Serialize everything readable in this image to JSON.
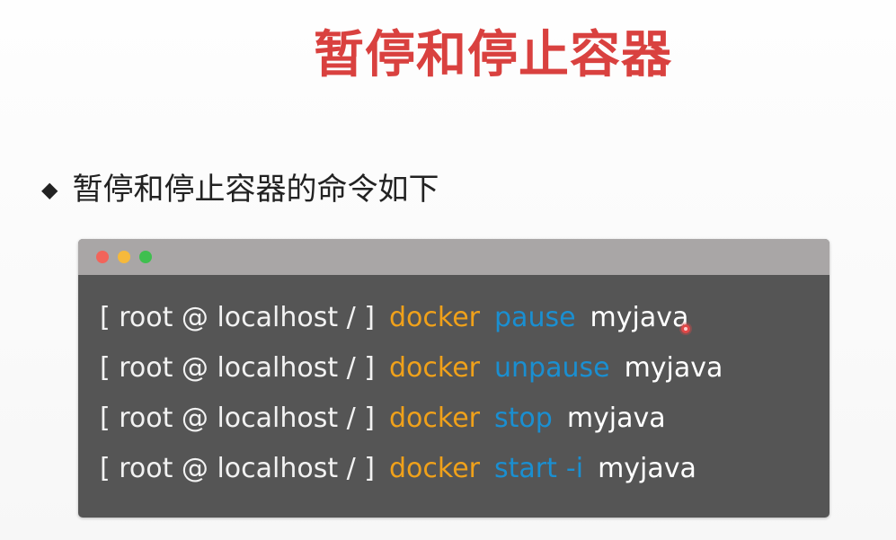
{
  "slide": {
    "title": "暂停和停止容器",
    "bullet_text": "暂停和停止容器的命令如下",
    "bullet_icon": "diamond-bullet-icon"
  },
  "terminal": {
    "window_controls": [
      "close-dot",
      "minimize-dot",
      "maximize-dot"
    ],
    "lines": [
      {
        "prompt": "[ root @ localhost / ]",
        "command": "docker",
        "subcommand": "pause",
        "flag": "",
        "target": "myjava"
      },
      {
        "prompt": "[ root @ localhost / ]",
        "command": "docker",
        "subcommand": "unpause",
        "flag": "",
        "target": "myjava"
      },
      {
        "prompt": "[ root @ localhost / ]",
        "command": "docker",
        "subcommand": "stop",
        "flag": "",
        "target": "myjava"
      },
      {
        "prompt": "[ root @ localhost / ]",
        "command": "docker",
        "subcommand": "start",
        "flag": "-i",
        "target": "myjava"
      }
    ]
  },
  "colors": {
    "title": "#d9413f",
    "text": "#222222",
    "terminal_bg": "#555555",
    "titlebar_bg": "#a9a6a6",
    "prompt": "#f2f2f2",
    "command": "#f0a11a",
    "subcommand": "#1a8fd1",
    "target": "#ffffff",
    "dot_red": "#f2645a",
    "dot_yellow": "#f6b93b",
    "dot_green": "#3fbf4f",
    "cursor": "#e04848"
  }
}
